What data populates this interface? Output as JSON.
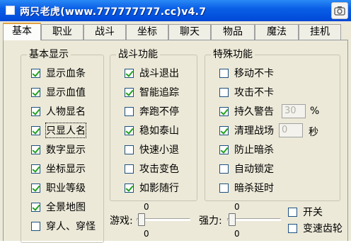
{
  "window": {
    "title": "两只老虎(www.777777777.cc)v4.7"
  },
  "tabs": [
    {
      "label": "基本"
    },
    {
      "label": "职业"
    },
    {
      "label": "战斗"
    },
    {
      "label": "坐标"
    },
    {
      "label": "聊天"
    },
    {
      "label": "物品"
    },
    {
      "label": "魔法"
    },
    {
      "label": "挂机"
    }
  ],
  "groups": {
    "basic_display": {
      "title": "基本显示",
      "items": [
        {
          "label": "显示血条",
          "checked": true
        },
        {
          "label": "显示血值",
          "checked": true
        },
        {
          "label": "人物显名",
          "checked": true
        },
        {
          "label": "只显人名",
          "checked": true
        },
        {
          "label": "数字显示",
          "checked": true
        },
        {
          "label": "坐标显示",
          "checked": true
        },
        {
          "label": "职业等级",
          "checked": true
        },
        {
          "label": "全景地图",
          "checked": true
        },
        {
          "label": "穿人、穿怪",
          "checked": false
        }
      ]
    },
    "combat": {
      "title": "战斗功能",
      "items": [
        {
          "label": "战斗退出",
          "checked": true
        },
        {
          "label": "智能追踪",
          "checked": true
        },
        {
          "label": "奔跑不停",
          "checked": false
        },
        {
          "label": "稳如泰山",
          "checked": true
        },
        {
          "label": "快速小退",
          "checked": false
        },
        {
          "label": "攻击变色",
          "checked": false
        },
        {
          "label": "如影随行",
          "checked": true
        }
      ]
    },
    "special": {
      "title": "特殊功能",
      "items": [
        {
          "label": "移动不卡",
          "checked": false
        },
        {
          "label": "攻击不卡",
          "checked": false
        },
        {
          "label": "持久警告",
          "checked": true
        },
        {
          "label": "清理战场",
          "checked": true
        },
        {
          "label": "防止暗杀",
          "checked": true
        },
        {
          "label": "自动锁定",
          "checked": false
        },
        {
          "label": "暗杀延时",
          "checked": false
        }
      ],
      "durability_value": "30",
      "durability_unit": "%",
      "cleanup_value": "0",
      "cleanup_unit": "秒"
    }
  },
  "sliders": {
    "game": {
      "label": "游戏:",
      "top_value": "0",
      "bottom_value": "0",
      "level": 0
    },
    "strength": {
      "label": "强力:",
      "top_value": "0",
      "bottom_value": "0",
      "level": 0
    }
  },
  "extra": {
    "switch_label": "开关",
    "switch_checked": false,
    "gear_label": "变速齿轮",
    "gear_checked": false
  },
  "colors": {
    "titlebar": "#0a5fe6",
    "check_mark": "#21a121",
    "tab_active_accent": "#e0a040"
  }
}
